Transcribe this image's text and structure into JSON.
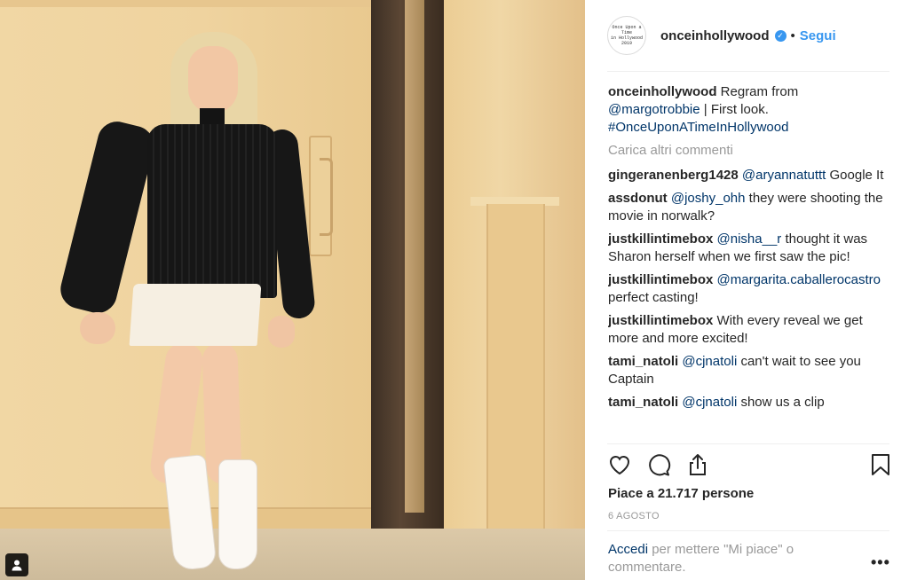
{
  "post": {
    "username": "onceinhollywood",
    "follow_label": "Segui",
    "separator": "•",
    "avatar_lines": [
      "Once Upon a Time",
      "in Hollywood",
      "2019"
    ]
  },
  "caption": {
    "user": "onceinhollywood",
    "text_1": "Regram from",
    "mention": "@margotrobbie",
    "text_2": "| First look.",
    "hashtag": "#OnceUponATimeInHollywood"
  },
  "load_more_label": "Carica altri commenti",
  "comments": [
    {
      "user": "gingeranenberg1428",
      "mention": "@aryannatuttt",
      "text": "Google It"
    },
    {
      "user": "assdonut",
      "mention": "@joshy_ohh",
      "text": "they were shooting the movie in norwalk?"
    },
    {
      "user": "justkillintimebox",
      "mention": "@nisha__r",
      "text": "thought it was Sharon herself when we first saw the pic!"
    },
    {
      "user": "justkillintimebox",
      "mention": "@margarita.caballerocastro",
      "text": "perfect casting!"
    },
    {
      "user": "justkillintimebox",
      "mention": "",
      "text": "With every reveal we get more and more excited!"
    },
    {
      "user": "tami_natoli",
      "mention": "@cjnatoli",
      "text": "can't wait to see you Captain"
    },
    {
      "user": "tami_natoli",
      "mention": "@cjnatoli",
      "text": "show us a clip"
    }
  ],
  "likes_label": "Piace a 21.717 persone",
  "date_label": "6 agosto",
  "login": {
    "link": "Accedi",
    "text": "per mettere \"Mi piace\" o commentare."
  },
  "more_label": "•••",
  "icons": [
    "heart-icon",
    "comment-icon",
    "share-icon",
    "bookmark-icon",
    "user-tag-icon",
    "verified-badge-icon"
  ],
  "colors": {
    "accent": "#3897f0",
    "link": "#003569",
    "muted": "#999999"
  }
}
